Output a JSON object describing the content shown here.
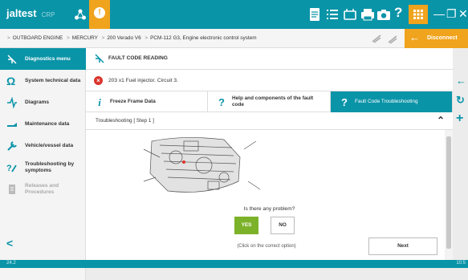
{
  "app": {
    "logo_text": "jaltest",
    "logo_sub": "CRP",
    "accent": "#0a94a8",
    "warning_color": "#f0a31c",
    "icons": [
      "document-icon",
      "list-icon",
      "keyboard-icon",
      "printer-icon",
      "camera-icon",
      "help-icon",
      "apps-icon"
    ],
    "window_controls": [
      "minimize-icon",
      "maximize-icon",
      "close-icon"
    ]
  },
  "breadcrumb": [
    "OUTBOARD ENGINE",
    "MERCURY",
    "200 Verado V6",
    "PCM-112 G3, Engine electronic control system"
  ],
  "disconnect_label": "Disconnect",
  "sidebar": {
    "items": [
      {
        "label": "Diagnostics menu",
        "icon": "diagnostics-icon",
        "active": true
      },
      {
        "label": "System technical data",
        "icon": "ohm-icon"
      },
      {
        "label": "Diagrams",
        "icon": "diagram-icon"
      },
      {
        "label": "Maintenance data",
        "icon": "oil-can-icon"
      },
      {
        "label": "Vehicle/vessel data",
        "icon": "wrench-icon"
      },
      {
        "label": "Troubleshooting by symptoms",
        "icon": "troubleshoot-icon"
      },
      {
        "label": "Releases and Procedures",
        "icon": "releases-icon",
        "disabled": true
      }
    ]
  },
  "header": {
    "title": "FAULT CODE READING"
  },
  "fault": {
    "text": "203  x1  Fuel injector. Circuit 3."
  },
  "tabs": [
    {
      "label": "Freeze Frame Data",
      "icon": "i"
    },
    {
      "label": "Help and components of the fault code",
      "icon": "?"
    },
    {
      "label": "Fault Code Troubleshooting",
      "icon": "?",
      "active": true
    }
  ],
  "step": {
    "label": "Troubleshooting [ Step 1 ]"
  },
  "question": {
    "text": "Is there any problem?",
    "yes": "YES",
    "no": "NO",
    "hint": "(Click on the correct option)"
  },
  "next_label": "Next",
  "footer": {
    "version": "24.2",
    "time": "10:5"
  }
}
